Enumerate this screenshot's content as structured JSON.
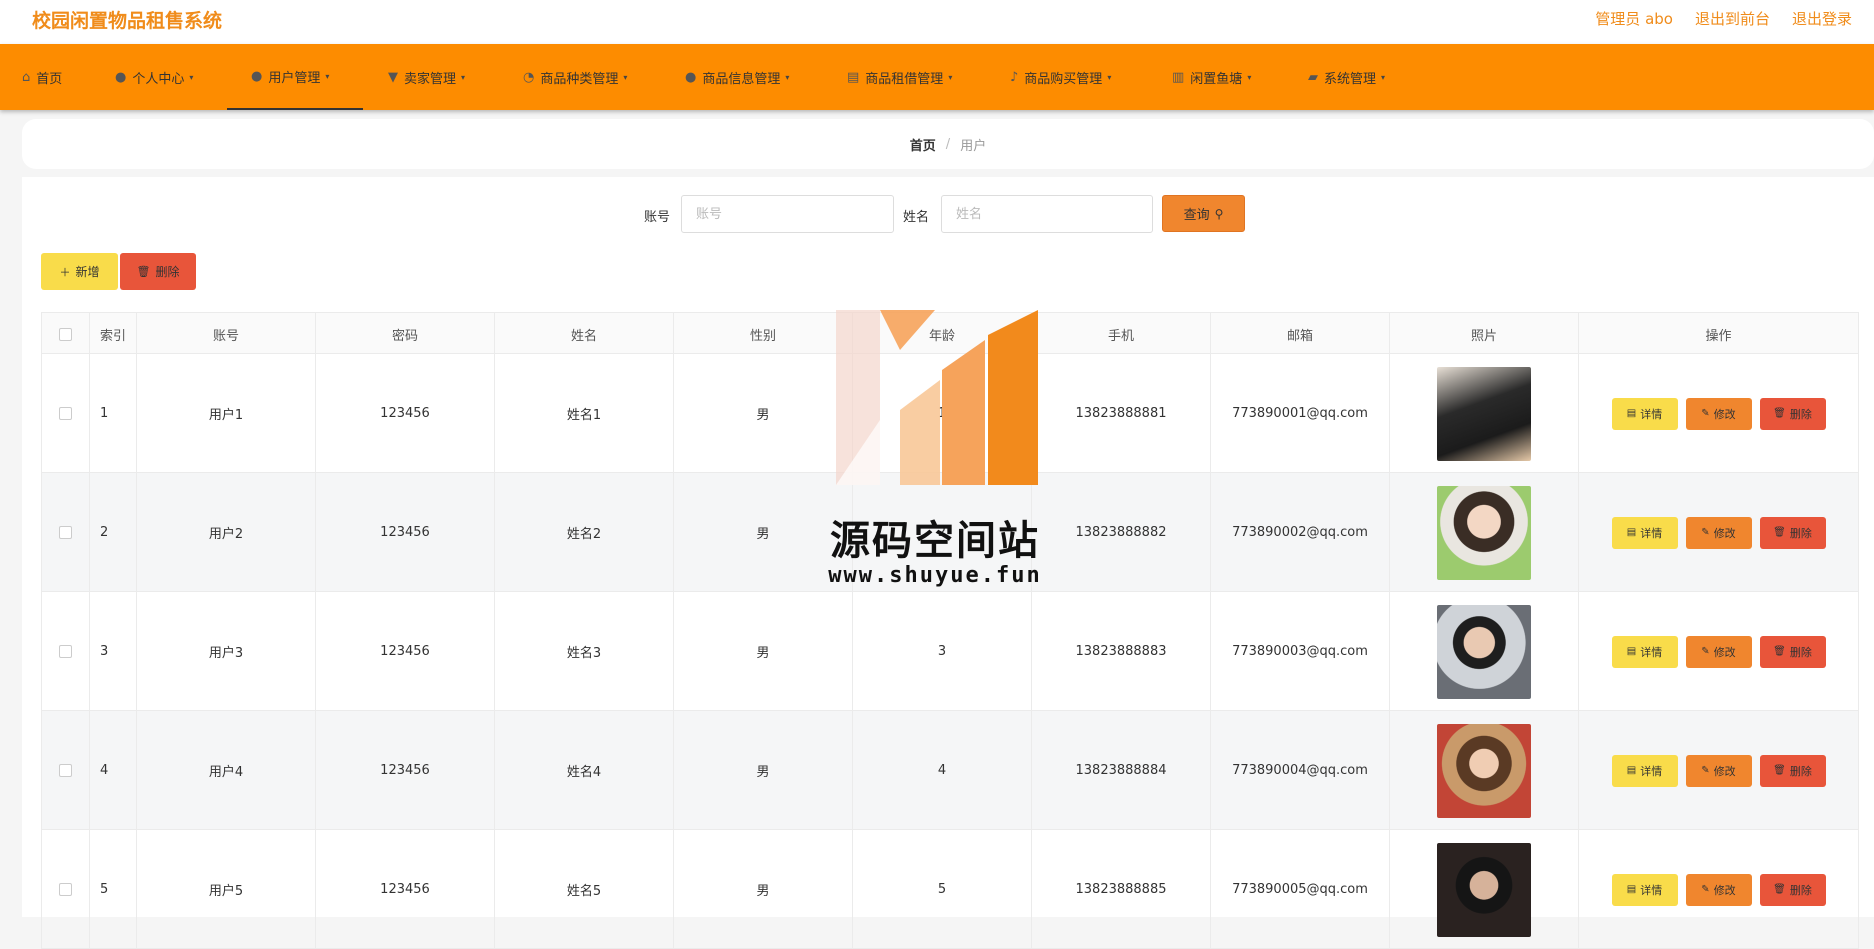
{
  "app": {
    "title": "校园闲置物品租售系统"
  },
  "top_links": {
    "admin": "管理员 abo",
    "to_front": "退出到前台",
    "logout": "退出登录"
  },
  "nav": [
    {
      "label": "首页",
      "icon": "home-icon",
      "glyph": "⌂"
    },
    {
      "label": "个人中心",
      "icon": "user-icon",
      "glyph": "👤"
    },
    {
      "label": "用户管理",
      "icon": "user-icon",
      "glyph": "👤"
    },
    {
      "label": "卖家管理",
      "icon": "trophy-icon",
      "glyph": "🏆"
    },
    {
      "label": "商品种类管理",
      "icon": "clock-icon",
      "glyph": "◔"
    },
    {
      "label": "商品信息管理",
      "icon": "person-icon",
      "glyph": "👤"
    },
    {
      "label": "商品租借管理",
      "icon": "doc-icon",
      "glyph": "▤"
    },
    {
      "label": "商品购买管理",
      "icon": "mic-icon",
      "glyph": "🎤"
    },
    {
      "label": "闲置鱼塘",
      "icon": "chart-icon",
      "glyph": "▥"
    },
    {
      "label": "系统管理",
      "icon": "briefcase-icon",
      "glyph": "▰"
    }
  ],
  "breadcrumb": {
    "home": "首页",
    "sep": "/",
    "current": "用户"
  },
  "search": {
    "account_label": "账号",
    "account_placeholder": "账号",
    "name_label": "姓名",
    "name_placeholder": "姓名",
    "query_label": "查询"
  },
  "toolbar": {
    "add_label": "新增",
    "delete_label": "删除"
  },
  "table": {
    "headers": [
      "索引",
      "账号",
      "密码",
      "姓名",
      "性别",
      "年龄",
      "手机",
      "邮箱",
      "照片",
      "操作"
    ],
    "rows": [
      {
        "index": "1",
        "account": "用户1",
        "password": "123456",
        "name": "姓名1",
        "gender": "男",
        "age": "1",
        "phone": "13823888881",
        "email": "773890001@qq.com"
      },
      {
        "index": "2",
        "account": "用户2",
        "password": "123456",
        "name": "姓名2",
        "gender": "男",
        "age": "2",
        "phone": "13823888882",
        "email": "773890002@qq.com"
      },
      {
        "index": "3",
        "account": "用户3",
        "password": "123456",
        "name": "姓名3",
        "gender": "男",
        "age": "3",
        "phone": "13823888883",
        "email": "773890003@qq.com"
      },
      {
        "index": "4",
        "account": "用户4",
        "password": "123456",
        "name": "姓名4",
        "gender": "男",
        "age": "4",
        "phone": "13823888884",
        "email": "773890004@qq.com"
      },
      {
        "index": "5",
        "account": "用户5",
        "password": "123456",
        "name": "姓名5",
        "gender": "男",
        "age": "5",
        "phone": "13823888885",
        "email": "773890005@qq.com"
      }
    ],
    "ops": {
      "detail": "详情",
      "edit": "修改",
      "delete": "删除"
    }
  },
  "watermark": {
    "text": "源码空间站",
    "url": "www.shuyue.fun"
  },
  "colors": {
    "accent": "#fd8c00",
    "title": "#f08c1b",
    "yellow": "#f9dc4a",
    "orange": "#f0862e",
    "red": "#e8553a"
  }
}
